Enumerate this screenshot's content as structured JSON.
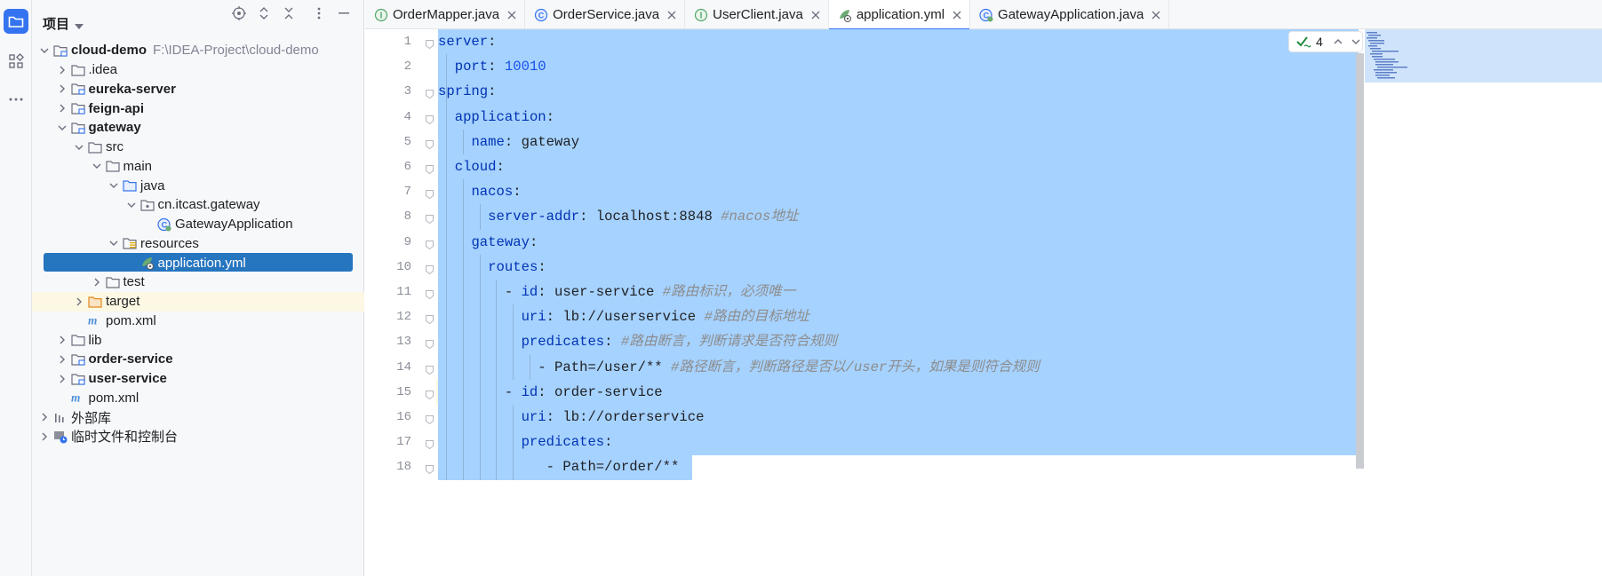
{
  "toolstrip": {
    "items": [
      "folder-icon",
      "structure-icon",
      "more-icon"
    ]
  },
  "project_panel": {
    "title": "项目",
    "tree": [
      {
        "label": "cloud-demo",
        "path": "F:\\IDEA-Project\\cloud-demo",
        "bold": true,
        "depth": 0,
        "arrow": "down",
        "icon": "module-folder"
      },
      {
        "label": ".idea",
        "depth": 1,
        "arrow": "right",
        "icon": "folder"
      },
      {
        "label": "eureka-server",
        "bold": true,
        "depth": 1,
        "arrow": "right",
        "icon": "module-folder"
      },
      {
        "label": "feign-api",
        "bold": true,
        "depth": 1,
        "arrow": "right",
        "icon": "module-folder"
      },
      {
        "label": "gateway",
        "bold": true,
        "depth": 1,
        "arrow": "down",
        "icon": "module-folder"
      },
      {
        "label": "src",
        "depth": 2,
        "arrow": "down",
        "icon": "folder"
      },
      {
        "label": "main",
        "depth": 3,
        "arrow": "down",
        "icon": "folder"
      },
      {
        "label": "java",
        "depth": 4,
        "arrow": "down",
        "icon": "source-folder"
      },
      {
        "label": "cn.itcast.gateway",
        "depth": 5,
        "arrow": "down",
        "icon": "package"
      },
      {
        "label": "GatewayApplication",
        "depth": 6,
        "arrow": "none",
        "icon": "spring-class"
      },
      {
        "label": "resources",
        "depth": 4,
        "arrow": "down",
        "icon": "resources-folder"
      },
      {
        "label": "application.yml",
        "depth": 5,
        "arrow": "none",
        "icon": "yaml-file",
        "selected": true
      },
      {
        "label": "test",
        "depth": 3,
        "arrow": "right",
        "icon": "folder"
      },
      {
        "label": "target",
        "depth": 2,
        "arrow": "right",
        "icon": "excluded-folder",
        "highlight": true
      },
      {
        "label": "pom.xml",
        "depth": 2,
        "arrow": "none",
        "icon": "maven-file"
      },
      {
        "label": "lib",
        "depth": 1,
        "arrow": "right",
        "icon": "folder"
      },
      {
        "label": "order-service",
        "bold": true,
        "depth": 1,
        "arrow": "right",
        "icon": "module-folder"
      },
      {
        "label": "user-service",
        "bold": true,
        "depth": 1,
        "arrow": "right",
        "icon": "module-folder"
      },
      {
        "label": "pom.xml",
        "depth": 1,
        "arrow": "none",
        "icon": "maven-file"
      },
      {
        "label": "外部库",
        "depth": 0,
        "arrow": "right",
        "icon": "library"
      },
      {
        "label": "临时文件和控制台",
        "depth": 0,
        "arrow": "right",
        "icon": "scratches"
      }
    ]
  },
  "tabs": [
    {
      "label": "OrderMapper.java",
      "icon": "interface-icon",
      "active": false
    },
    {
      "label": "OrderService.java",
      "icon": "class-icon",
      "active": false
    },
    {
      "label": "UserClient.java",
      "icon": "interface-icon",
      "active": false
    },
    {
      "label": "application.yml",
      "icon": "yaml-icon",
      "active": true
    },
    {
      "label": "GatewayApplication.java",
      "icon": "spring-class-icon",
      "active": false
    }
  ],
  "editor": {
    "inspection_count": "4",
    "current_line": "15",
    "line_numbers": [
      "1",
      "2",
      "3",
      "4",
      "5",
      "6",
      "7",
      "8",
      "9",
      "10",
      "11",
      "12",
      "13",
      "14",
      "15",
      "16",
      "17",
      "18"
    ],
    "lines": [
      {
        "indent": "",
        "key": "server",
        "sep": ":",
        "value": "",
        "comment": ""
      },
      {
        "indent": "  ",
        "key": "port",
        "sep": ": ",
        "value": "10010",
        "num": true,
        "comment": ""
      },
      {
        "indent": "",
        "key": "spring",
        "sep": ":",
        "value": "",
        "comment": ""
      },
      {
        "indent": "  ",
        "key": "application",
        "sep": ":",
        "value": "",
        "comment": ""
      },
      {
        "indent": "    ",
        "key": "name",
        "sep": ": ",
        "value": "gateway",
        "comment": ""
      },
      {
        "indent": "  ",
        "key": "cloud",
        "sep": ":",
        "value": "",
        "comment": ""
      },
      {
        "indent": "    ",
        "key": "nacos",
        "sep": ":",
        "value": "",
        "comment": ""
      },
      {
        "indent": "      ",
        "key": "server-addr",
        "sep": ": ",
        "value": "localhost:8848 ",
        "comment": "#nacos地址"
      },
      {
        "indent": "    ",
        "key": "gateway",
        "sep": ":",
        "value": "",
        "comment": ""
      },
      {
        "indent": "      ",
        "key": "routes",
        "sep": ":",
        "value": "",
        "comment": ""
      },
      {
        "indent": "        - ",
        "key": "id",
        "sep": ": ",
        "value": "user-service ",
        "comment": "#路由标识，必须唯一"
      },
      {
        "indent": "          ",
        "key": "uri",
        "sep": ": ",
        "value": "lb://userservice ",
        "comment": "#路由的目标地址"
      },
      {
        "indent": "          ",
        "key": "predicates",
        "sep": ": ",
        "value": "",
        "comment": "#路由断言，判断请求是否符合规则"
      },
      {
        "indent": "            ",
        "key": "",
        "sep": "",
        "value": "- Path=/user/** ",
        "comment": "#路径断言，判断路径是否以/user开头，如果是则符合规则"
      },
      {
        "indent": "        - ",
        "key": "id",
        "sep": ": ",
        "value": "order-service",
        "comment": ""
      },
      {
        "indent": "          ",
        "key": "uri",
        "sep": ": ",
        "value": "lb://orderservice",
        "comment": ""
      },
      {
        "indent": "          ",
        "key": "predicates",
        "sep": ":",
        "value": "",
        "comment": ""
      },
      {
        "indent": "             ",
        "key": "",
        "sep": "",
        "value": "- Path=/order/**",
        "comment": ""
      }
    ]
  },
  "colors": {
    "accent": "#3574f0",
    "selection": "#a6d2ff",
    "tree_selection": "#2675bf",
    "yaml_key": "#0033b3",
    "number": "#1750eb",
    "comment": "#8c8c8c"
  }
}
